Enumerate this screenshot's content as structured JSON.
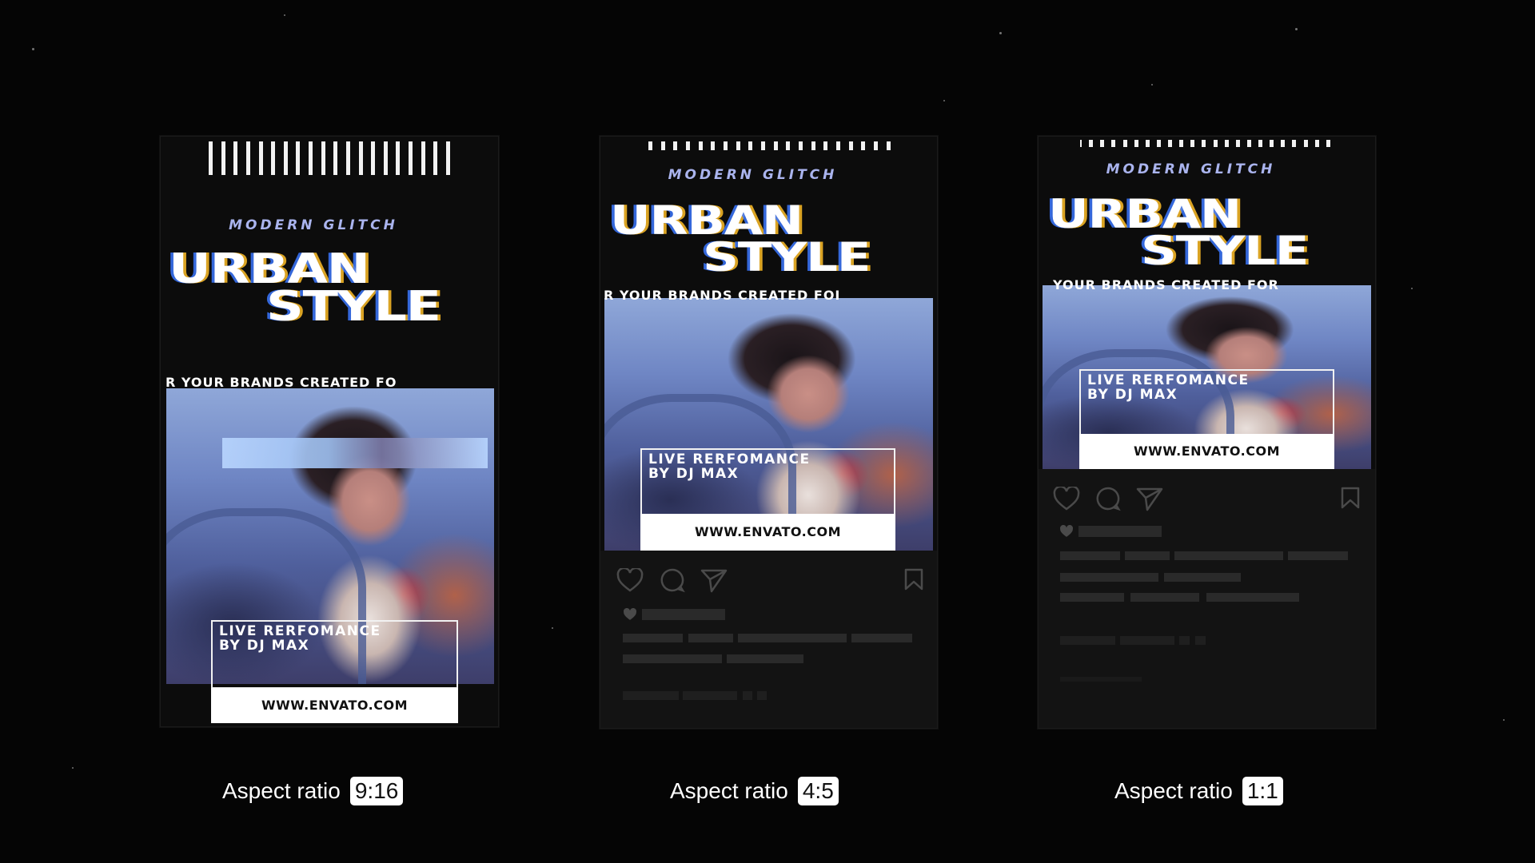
{
  "colors": {
    "background": "#050505",
    "card_background": "#0c0c0c",
    "social_background": "#131313",
    "kicker_text": "#aab4ee",
    "skeleton": "#2a2a2a",
    "url_box": "#ffffff"
  },
  "cards": [
    {
      "id": "story",
      "kicker": "MODERN GLITCH",
      "headline_line1": "URBAN",
      "headline_line2": "STYLE",
      "ticker": "R YOUR BRANDS   CREATED FO",
      "overlay_line1": "LIVE RERFOMANCE",
      "overlay_line2": "BY DJ MAX",
      "url": "WWW.ENVATO.COM",
      "caption": "Aspect ratio",
      "ratio": "9:16"
    },
    {
      "id": "portrait",
      "kicker": "MODERN GLITCH",
      "headline_line1": "URBAN",
      "headline_line2": "STYLE",
      "ticker": "R YOUR BRANDS   CREATED FOI",
      "overlay_line1": "LIVE RERFOMANCE",
      "overlay_line2": "BY DJ MAX",
      "url": "WWW.ENVATO.COM",
      "caption": "Aspect ratio",
      "ratio": "4:5",
      "icons": [
        "heart-icon",
        "comment-icon",
        "share-icon",
        "bookmark-icon"
      ]
    },
    {
      "id": "square",
      "kicker": "MODERN GLITCH",
      "headline_line1": "URBAN",
      "headline_line2": "STYLE",
      "ticker": "YOUR BRANDS   CREATED FOR",
      "overlay_line1": "LIVE RERFOMANCE",
      "overlay_line2": "BY DJ MAX",
      "url": "WWW.ENVATO.COM",
      "caption": "Aspect ratio",
      "ratio": "1:1",
      "icons": [
        "heart-icon",
        "comment-icon",
        "share-icon",
        "bookmark-icon"
      ]
    }
  ]
}
